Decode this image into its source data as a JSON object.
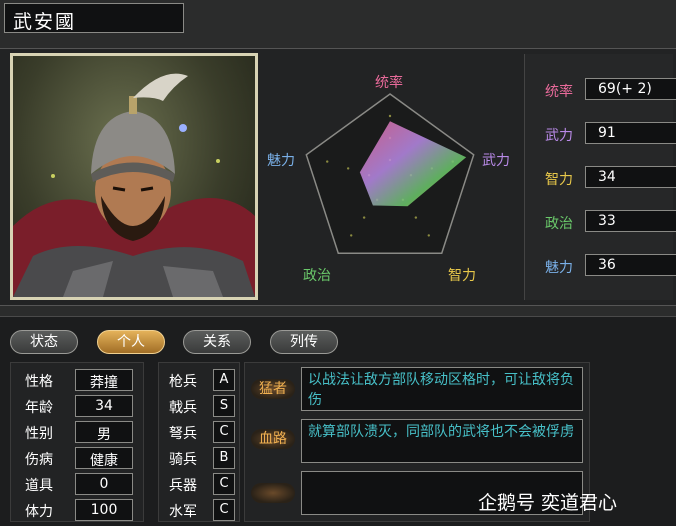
{
  "header": {
    "name": "武安國"
  },
  "radar": {
    "labels": {
      "leadership": "统率",
      "war": "武力",
      "intelligence": "智力",
      "politics": "政治",
      "charisma": "魅力"
    },
    "values": {
      "leadership": 69,
      "war": 91,
      "intelligence": 34,
      "politics": 33,
      "charisma": 36
    },
    "colors": {
      "leadership": "#e86a9a",
      "war": "#b98ae8",
      "intelligence": "#e8c84a",
      "politics": "#6ac86a",
      "charisma": "#7ab0e8"
    }
  },
  "stats": [
    {
      "label": "统率",
      "value": "69(+ 2)",
      "color": "#e86a9a"
    },
    {
      "label": "武力",
      "value": "91",
      "color": "#b98ae8"
    },
    {
      "label": "智力",
      "value": "34",
      "color": "#e8c84a"
    },
    {
      "label": "政治",
      "value": "33",
      "color": "#6ac86a"
    },
    {
      "label": "魅力",
      "value": "36",
      "color": "#7ab0e8"
    }
  ],
  "tabs": [
    {
      "label": "状态",
      "active": false
    },
    {
      "label": "个人",
      "active": true
    },
    {
      "label": "关系",
      "active": false
    },
    {
      "label": "列传",
      "active": false
    }
  ],
  "personal": [
    {
      "label": "性格",
      "value": "莽撞"
    },
    {
      "label": "年龄",
      "value": "34"
    },
    {
      "label": "性别",
      "value": "男"
    },
    {
      "label": "伤病",
      "value": "健康"
    },
    {
      "label": "道具",
      "value": "0"
    },
    {
      "label": "体力",
      "value": "100"
    }
  ],
  "aptitudes": [
    {
      "label": "枪兵",
      "value": "A"
    },
    {
      "label": "戟兵",
      "value": "S"
    },
    {
      "label": "弩兵",
      "value": "C"
    },
    {
      "label": "骑兵",
      "value": "B"
    },
    {
      "label": "兵器",
      "value": "C"
    },
    {
      "label": "水军",
      "value": "C"
    }
  ],
  "skills": [
    {
      "name": "猛者",
      "desc": "以战法让敌方部队移动区格时，可让敌将负伤"
    },
    {
      "name": "血路",
      "desc": "就算部队溃灭，同部队的武将也不会被俘虏"
    },
    {
      "name": "",
      "desc": ""
    }
  ],
  "watermark": "企鹅号 奕道君心"
}
